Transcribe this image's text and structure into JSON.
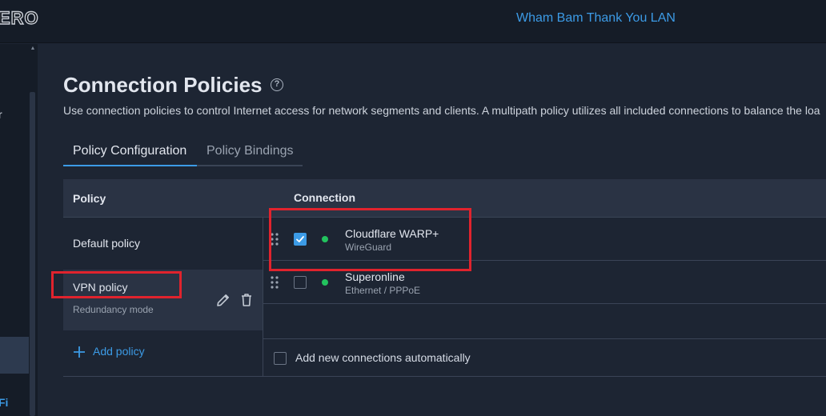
{
  "header": {
    "logo_text": "ERO",
    "network_name": "Wham Bam Thank You LAN"
  },
  "sidebar": {
    "fragment_top": "r",
    "fragment_bottom": "Fi"
  },
  "page": {
    "title": "Connection Policies",
    "help_icon": "?",
    "description": "Use connection policies to control Internet access for network segments and clients. A multipath policy utilizes all included connections to balance the loa"
  },
  "tabs": [
    {
      "label": "Policy Configuration",
      "active": true
    },
    {
      "label": "Policy Bindings",
      "active": false
    }
  ],
  "table": {
    "columns": [
      "Policy",
      "Connection"
    ],
    "policies": [
      {
        "name": "Default policy",
        "subtitle": ""
      },
      {
        "name": "VPN policy",
        "subtitle": "Redundancy mode"
      }
    ],
    "add_policy_label": "Add policy",
    "connections": [
      {
        "name": "Cloudflare WARP+",
        "type": "WireGuard",
        "checked": true,
        "status": "online"
      },
      {
        "name": "Superonline",
        "type": "Ethernet / PPPoE",
        "checked": false,
        "status": "online"
      }
    ],
    "auto_add_label": "Add new connections automatically",
    "auto_add_checked": false
  },
  "colors": {
    "accent": "#3c9be6",
    "status_online": "#22c35e",
    "highlight": "#e0232d"
  },
  "icons": {
    "help": "help-circle-icon",
    "edit": "pencil-icon",
    "delete": "trash-icon",
    "add": "plus-icon",
    "drag": "drag-handle-icon",
    "check": "checkmark-icon"
  }
}
